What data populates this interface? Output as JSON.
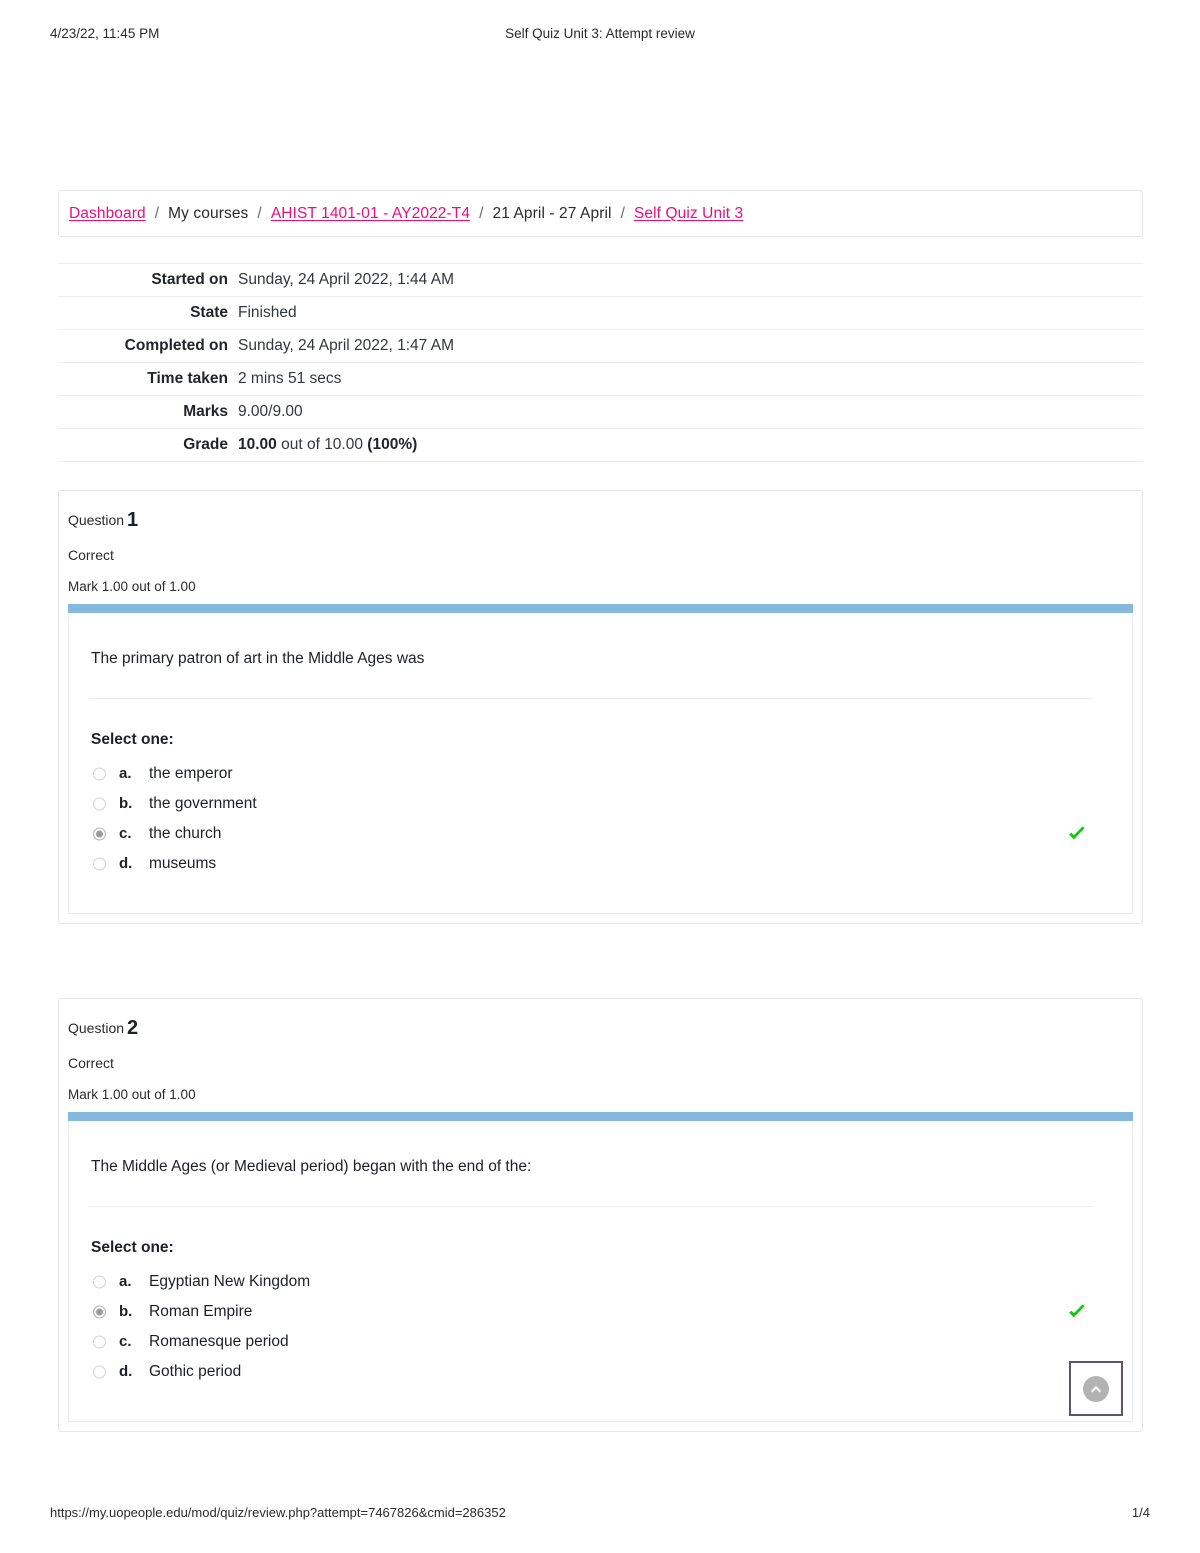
{
  "print_header": {
    "timestamp": "4/23/22, 11:45 PM",
    "title": "Self Quiz Unit 3: Attempt review"
  },
  "breadcrumb": {
    "items": [
      {
        "label": "Dashboard",
        "link": true
      },
      {
        "label": "My courses",
        "link": false
      },
      {
        "label": "AHIST 1401-01 - AY2022-T4",
        "link": true
      },
      {
        "label": "21 April - 27 April",
        "link": false
      },
      {
        "label": "Self Quiz Unit 3",
        "link": true
      }
    ],
    "separator": "/"
  },
  "summary": {
    "rows": [
      {
        "label": "Started on",
        "value": "Sunday, 24 April 2022, 1:44 AM",
        "bold_value": false
      },
      {
        "label": "State",
        "value": "Finished",
        "bold_value": false
      },
      {
        "label": "Completed on",
        "value": "Sunday, 24 April 2022, 1:47 AM",
        "bold_value": false
      },
      {
        "label": "Time taken",
        "value": "2 mins 51 secs",
        "bold_value": false
      },
      {
        "label": "Marks",
        "value": "9.00/9.00",
        "bold_value": false
      },
      {
        "label": "Grade",
        "value": "10.00 out of 10.00 (100%)",
        "bold_value": true,
        "value_bold_parts": [
          "10.00",
          "(100%)"
        ],
        "value_plain_part": " out of 10.00 "
      }
    ]
  },
  "questions": [
    {
      "number_label": "Question",
      "number": "1",
      "state": "Correct",
      "grade": "Mark 1.00 out of 1.00",
      "text": "The primary patron of art in the Middle Ages was",
      "select_label": "Select one:",
      "answers": [
        {
          "letter": "a.",
          "text": "the emperor",
          "selected": false,
          "correct": false
        },
        {
          "letter": "b.",
          "text": "the government",
          "selected": false,
          "correct": false
        },
        {
          "letter": "c.",
          "text": "the church",
          "selected": true,
          "correct": true
        },
        {
          "letter": "d.",
          "text": "museums",
          "selected": false,
          "correct": false
        }
      ]
    },
    {
      "number_label": "Question",
      "number": "2",
      "state": "Correct",
      "grade": "Mark 1.00 out of 1.00",
      "text": "The Middle Ages (or Medieval period) began with the end of the:",
      "select_label": "Select one:",
      "answers": [
        {
          "letter": "a.",
          "text": "Egyptian New Kingdom",
          "selected": false,
          "correct": false
        },
        {
          "letter": "b.",
          "text": "Roman Empire",
          "selected": true,
          "correct": true
        },
        {
          "letter": "c.",
          "text": "Romanesque period",
          "selected": false,
          "correct": false
        },
        {
          "letter": "d.",
          "text": "Gothic period",
          "selected": false,
          "correct": false
        }
      ]
    }
  ],
  "back_to_top": {
    "icon": "chevron-up-icon",
    "label": ""
  },
  "print_footer": {
    "url": "https://my.uopeople.edu/mod/quiz/review.php?attempt=7467826&cmid=286352",
    "page": "1/4"
  },
  "colors": {
    "link": "#ee0c7c",
    "question_bar": "#85b8dd",
    "correct_tick": "#0ecb0e",
    "border": "#e6e7eb"
  }
}
